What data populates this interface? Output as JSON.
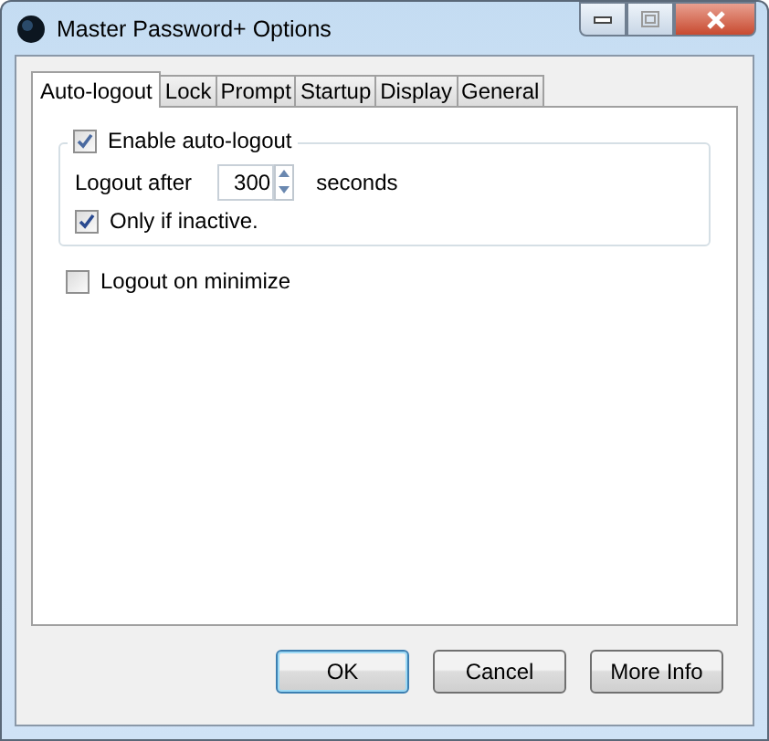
{
  "window": {
    "title": "Master Password+ Options"
  },
  "tabs": [
    {
      "label": "Auto-logout",
      "selected": true
    },
    {
      "label": "Lock",
      "selected": false
    },
    {
      "label": "Prompt",
      "selected": false
    },
    {
      "label": "Startup",
      "selected": false
    },
    {
      "label": "Display",
      "selected": false
    },
    {
      "label": "General",
      "selected": false
    }
  ],
  "auto_logout": {
    "label": "Enable auto-logout",
    "checked": true,
    "logout_after": {
      "label": "Logout after",
      "value": "300",
      "unit": "seconds"
    },
    "only_if_inactive": {
      "label": "Only if inactive.",
      "checked": true
    }
  },
  "logout_on_minimize": {
    "label": "Logout on minimize",
    "checked": false
  },
  "buttons": [
    {
      "label": "OK",
      "kind": "default"
    },
    {
      "label": "Cancel",
      "kind": "normal"
    },
    {
      "label": "More Info",
      "kind": "normal"
    }
  ]
}
